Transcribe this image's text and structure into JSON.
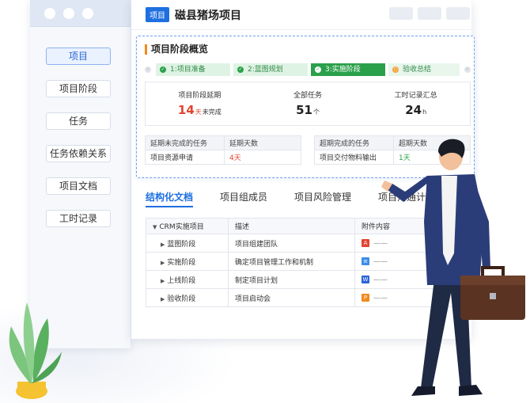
{
  "sidebar": {
    "items": [
      {
        "label": "项目",
        "active": true
      },
      {
        "label": "项目阶段",
        "active": false
      },
      {
        "label": "任务",
        "active": false
      },
      {
        "label": "任务依赖关系",
        "active": false
      },
      {
        "label": "项目文档",
        "active": false
      },
      {
        "label": "工时记录",
        "active": false
      }
    ]
  },
  "header": {
    "badge": "项目",
    "title": "磁县猪场项目"
  },
  "overview": {
    "title": "项目阶段概览",
    "steps": [
      {
        "label": "1:项目准备",
        "status": "done"
      },
      {
        "label": "2:蓝图规划",
        "status": "done"
      },
      {
        "label": "3:实施阶段",
        "status": "current"
      },
      {
        "label": "验收总结",
        "status": "todo"
      }
    ],
    "stats": {
      "delay": {
        "label": "项目阶段延期",
        "value": "14",
        "unit": "天",
        "note": "未完成"
      },
      "tasks": {
        "label": "全部任务",
        "value": "51",
        "unit": "个"
      },
      "hours": {
        "label": "工时记录汇总",
        "value": "24",
        "unit": "h"
      }
    },
    "overdue_unfinished": {
      "headers": [
        "延期未完成的任务",
        "延期天数"
      ],
      "rows": [
        [
          "项目资源申请",
          "4天"
        ]
      ]
    },
    "overdue_finished": {
      "headers": [
        "超期完成的任务",
        "超期天数"
      ],
      "rows": [
        [
          "项目交付物料输出",
          "1天"
        ]
      ]
    }
  },
  "tabs": [
    {
      "label": "结构化文档",
      "active": true
    },
    {
      "label": "项目组成员",
      "active": false
    },
    {
      "label": "项目风险管理",
      "active": false
    },
    {
      "label": "项目沟通计划",
      "active": false
    }
  ],
  "doc_table": {
    "headers": [
      "CRM实施项目",
      "描述",
      "附件内容"
    ],
    "rows": [
      {
        "phase": "蓝图阶段",
        "desc": "项目组建团队",
        "file_icon": "pdf-icon",
        "file_color": "#e5432f",
        "file_text": "——"
      },
      {
        "phase": "实施阶段",
        "desc": "确定项目管理工作和机制",
        "file_icon": "doc-icon",
        "file_color": "#3b8ee8",
        "file_text": "——"
      },
      {
        "phase": "上线阶段",
        "desc": "制定项目计划",
        "file_icon": "word-icon",
        "file_color": "#2a64d6",
        "file_text": "——"
      },
      {
        "phase": "验收阶段",
        "desc": "项目启动会",
        "file_icon": "ppt-icon",
        "file_color": "#f08a1c",
        "file_text": "——"
      }
    ]
  },
  "colors": {
    "accent": "#1e6fe0",
    "success": "#2aa04a",
    "danger": "#e5432f"
  }
}
